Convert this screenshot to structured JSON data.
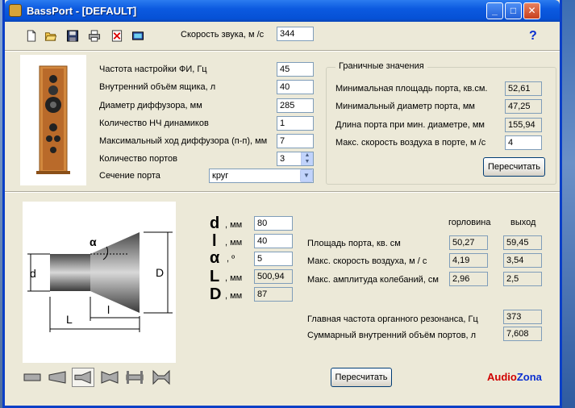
{
  "window": {
    "title": "BassPort - [DEFAULT]",
    "minimize_label": "_",
    "maximize_label": "□",
    "close_label": "✕"
  },
  "toolbar": {
    "icons": [
      "new-file-icon",
      "open-folder-icon",
      "save-icon",
      "print-icon",
      "delete-icon",
      "calculator-icon"
    ],
    "sound_speed_label": "Скорость звука, м /с",
    "sound_speed_value": "344",
    "help_label": "?"
  },
  "params": {
    "tuning_freq": {
      "label": "Частота настройки ФИ, Гц",
      "value": "45"
    },
    "box_volume": {
      "label": "Внутренний объём ящика, л",
      "value": "40"
    },
    "cone_diameter": {
      "label": "Диаметр диффузора, мм",
      "value": "285"
    },
    "woofer_count": {
      "label": "Количество НЧ динамиков",
      "value": "1"
    },
    "max_excursion": {
      "label": "Максимальный ход диффузора (п-п), мм",
      "value": "7"
    },
    "port_count": {
      "label": "Количество портов",
      "value": "3"
    },
    "port_section": {
      "label": "Сечение порта",
      "value": "круг"
    }
  },
  "limits": {
    "title": "Граничные значения",
    "min_area": {
      "label": "Минимальная площадь порта, кв.см.",
      "value": "52,61"
    },
    "min_diameter": {
      "label": "Минимальный диаметр порта, мм",
      "value": "47,25"
    },
    "length_at_min": {
      "label": "Длина порта при мин. диаметре, мм",
      "value": "155,94"
    },
    "max_air_speed": {
      "label": "Макс. скорость воздуха в порте, м /с",
      "value": "4"
    },
    "recalc_label": "Пересчитать"
  },
  "dims": {
    "d": {
      "symbol": "d",
      "unit": ", мм",
      "value": "80"
    },
    "l": {
      "symbol": "l",
      "unit": ", мм",
      "value": "40"
    },
    "alpha": {
      "symbol": "α",
      "unit": ", º",
      "value": "5"
    },
    "L": {
      "symbol": "L",
      "unit": ", мм",
      "value": "500,94"
    },
    "D": {
      "symbol": "D",
      "unit": ", мм",
      "value": "87"
    }
  },
  "diagram": {
    "label_d": "d",
    "label_D": "D",
    "label_L": "L",
    "label_l": "l",
    "label_alpha": "α"
  },
  "results": {
    "col_throat": "горловина",
    "col_exit": "выход",
    "port_area": {
      "label": "Площадь порта, кв. см",
      "throat": "50,27",
      "exit": "59,45"
    },
    "max_air_speed": {
      "label": "Макс. скорость воздуха, м / с",
      "throat": "4,19",
      "exit": "3,54"
    },
    "max_amplitude": {
      "label": "Макс. амплитуда колебаний, см",
      "throat": "2,96",
      "exit": "2,5"
    },
    "organ_resonance": {
      "label": "Главная частота органного резонанса, Гц",
      "value": "373"
    },
    "total_volume": {
      "label": "Суммарный внутренний объём портов, л",
      "value": "7,608"
    },
    "recalc_label": "Пересчитать"
  },
  "shape_buttons": [
    "straight-tube-icon",
    "cone-tube-icon",
    "cone-with-taper-icon",
    "double-flare-icon",
    "flanged-tube-icon",
    "double-flare-ends-icon"
  ],
  "brand": {
    "audio": "Audio",
    "zona": "Zona",
    "audio_color": "#d00000",
    "zona_color": "#0a2fd0"
  }
}
